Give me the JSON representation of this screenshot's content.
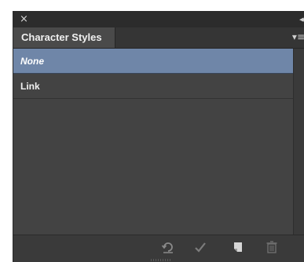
{
  "panel": {
    "close_glyph": "×",
    "collapse_glyph": "◂◂",
    "menu_glyph": "▾≡",
    "tab_label": "Character Styles",
    "items": [
      {
        "label": "None",
        "selected": true
      },
      {
        "label": "Link",
        "selected": false
      }
    ]
  },
  "footer": {
    "buttons": [
      {
        "name": "clear-overrides-button",
        "icon": "clear-overrides-icon"
      },
      {
        "name": "redefine-style-button",
        "icon": "checkmark-icon"
      },
      {
        "name": "new-style-button",
        "icon": "new-item-icon"
      },
      {
        "name": "delete-style-button",
        "icon": "trash-icon"
      }
    ]
  },
  "colors": {
    "panel_bg": "#434343",
    "selection": "#6f86a8",
    "titlebar": "#2c2c2c"
  }
}
